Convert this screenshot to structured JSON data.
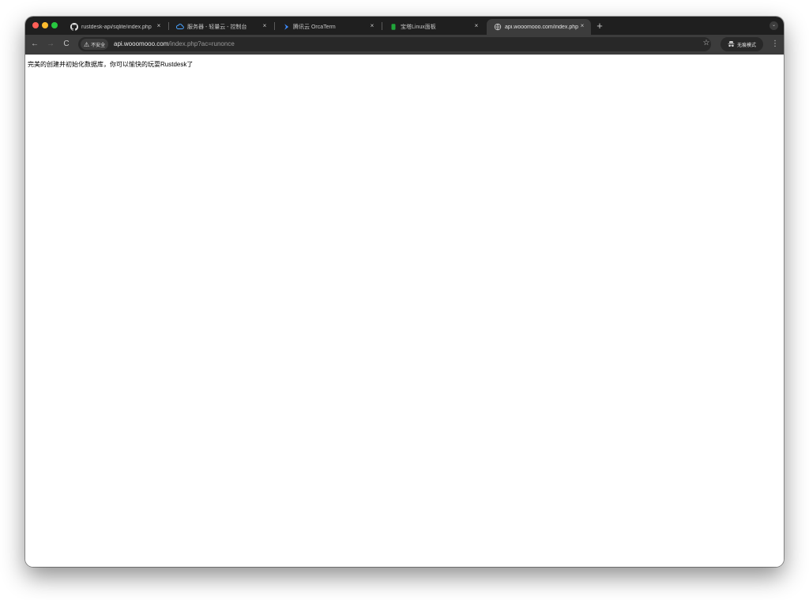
{
  "tabs": [
    {
      "title": "rustdesk-api/sqlite/index.php",
      "icon": "github-icon",
      "close": "×"
    },
    {
      "title": "服务器 - 轻量云 - 控制台",
      "icon": "cloud-icon",
      "close": "×"
    },
    {
      "title": "腾讯云 OrcaTerm",
      "icon": "orcaterm-icon",
      "close": "×"
    },
    {
      "title": "宝塔Linux面板",
      "icon": "baota-icon",
      "close": "×"
    },
    {
      "title": "api.wooomooo.com/index.php",
      "icon": "globe-icon",
      "close": "×",
      "active": true
    }
  ],
  "toolbar": {
    "new_tab": "+",
    "tab_menu": "⌄",
    "back": "←",
    "forward": "→",
    "reload": "C",
    "security_warning_icon": "⚠",
    "security_label": "不安全",
    "url_host": "api.wooomooo.com",
    "url_path": "/index.php?ac=runonce",
    "bookmark_star": "☆",
    "incognito_icon": "incognito-icon",
    "incognito_label": "无痕模式",
    "menu": "⋮"
  },
  "page": {
    "message": "完美的创建并初始化数据库，你可以愉快的玩耍Rustdesk了"
  },
  "colors": {
    "tabstrip_bg": "#1f1f1f",
    "toolbar_bg": "#3c3c3c",
    "omnibox_bg": "#282828",
    "page_bg": "#ffffff",
    "traffic_red": "#ff5f57",
    "traffic_yellow": "#febc2e",
    "traffic_green": "#28c840"
  }
}
